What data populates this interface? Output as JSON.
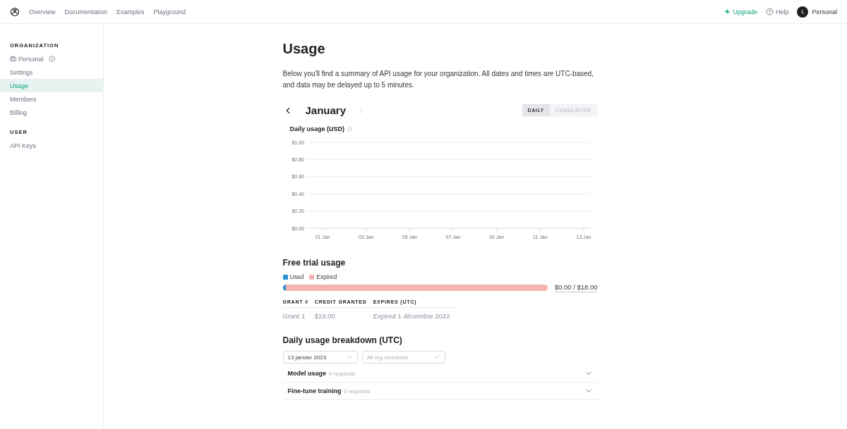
{
  "nav": {
    "links": [
      {
        "label": "Overview"
      },
      {
        "label": "Documentation"
      },
      {
        "label": "Examples"
      },
      {
        "label": "Playground"
      }
    ],
    "upgrade": "Upgrade",
    "help": "Help",
    "avatar": "L",
    "account": "Personal"
  },
  "sidebar": {
    "sections": [
      {
        "heading": "ORGANIZATION",
        "items": [
          {
            "label": "Personal",
            "kind": "org",
            "selected": false
          },
          {
            "label": "Settings",
            "kind": "link",
            "selected": false
          },
          {
            "label": "Usage",
            "kind": "link",
            "selected": true
          },
          {
            "label": "Members",
            "kind": "link",
            "selected": false
          },
          {
            "label": "Billing",
            "kind": "link",
            "selected": false
          }
        ]
      },
      {
        "heading": "USER",
        "items": [
          {
            "label": "API Keys",
            "kind": "link",
            "selected": false
          }
        ]
      }
    ]
  },
  "page": {
    "title": "Usage",
    "description": "Below you'll find a summary of API usage for your organization. All dates and times are UTC-based, and data may be delayed up to 5 minutes.",
    "month": "January",
    "tabs": [
      {
        "label": "DAILY",
        "selected": true
      },
      {
        "label": "CUMULATIVE",
        "selected": false
      }
    ],
    "chart_data": {
      "type": "line",
      "title": "Daily usage (USD)",
      "categories": [
        "01 Jan",
        "03 Jan",
        "05 Jan",
        "07 Jan",
        "09 Jan",
        "11 Jan",
        "13 Jan"
      ],
      "grid": true,
      "ylim": [
        0,
        1
      ],
      "yticks": [
        {
          "value": 0,
          "label": "$0.00"
        },
        {
          "value": 0.2,
          "label": "$0.20"
        },
        {
          "value": 0.4,
          "label": "$0.40"
        },
        {
          "value": 0.6,
          "label": "$0.60"
        },
        {
          "value": 0.8,
          "label": "$0.80"
        },
        {
          "value": 1,
          "label": "$1.00"
        }
      ]
    }
  },
  "free_trial": {
    "title": "Free trial usage",
    "legend": [
      {
        "label": "Used",
        "color": "#2d8fd5"
      },
      {
        "label": "Expired",
        "color": "#f3b3b3"
      }
    ],
    "level": 0,
    "amount": "$0.00 / $18.00",
    "columns": [
      "GRANT #",
      "CREDIT GRANTED",
      "EXPIRES (UTC)"
    ],
    "rows": [
      [
        "Grant 1",
        "$18.00",
        "Expired 1 décembre 2022"
      ]
    ]
  },
  "breakdown": {
    "title": "Daily usage breakdown (UTC)",
    "date": "13 janvier 2023",
    "members_placeholder": "All org members",
    "sections": [
      {
        "title": "Model usage",
        "count": "0 requests",
        "expanded": false
      },
      {
        "title": "Fine-tune training",
        "count": "0 requests",
        "expanded": false
      }
    ]
  }
}
